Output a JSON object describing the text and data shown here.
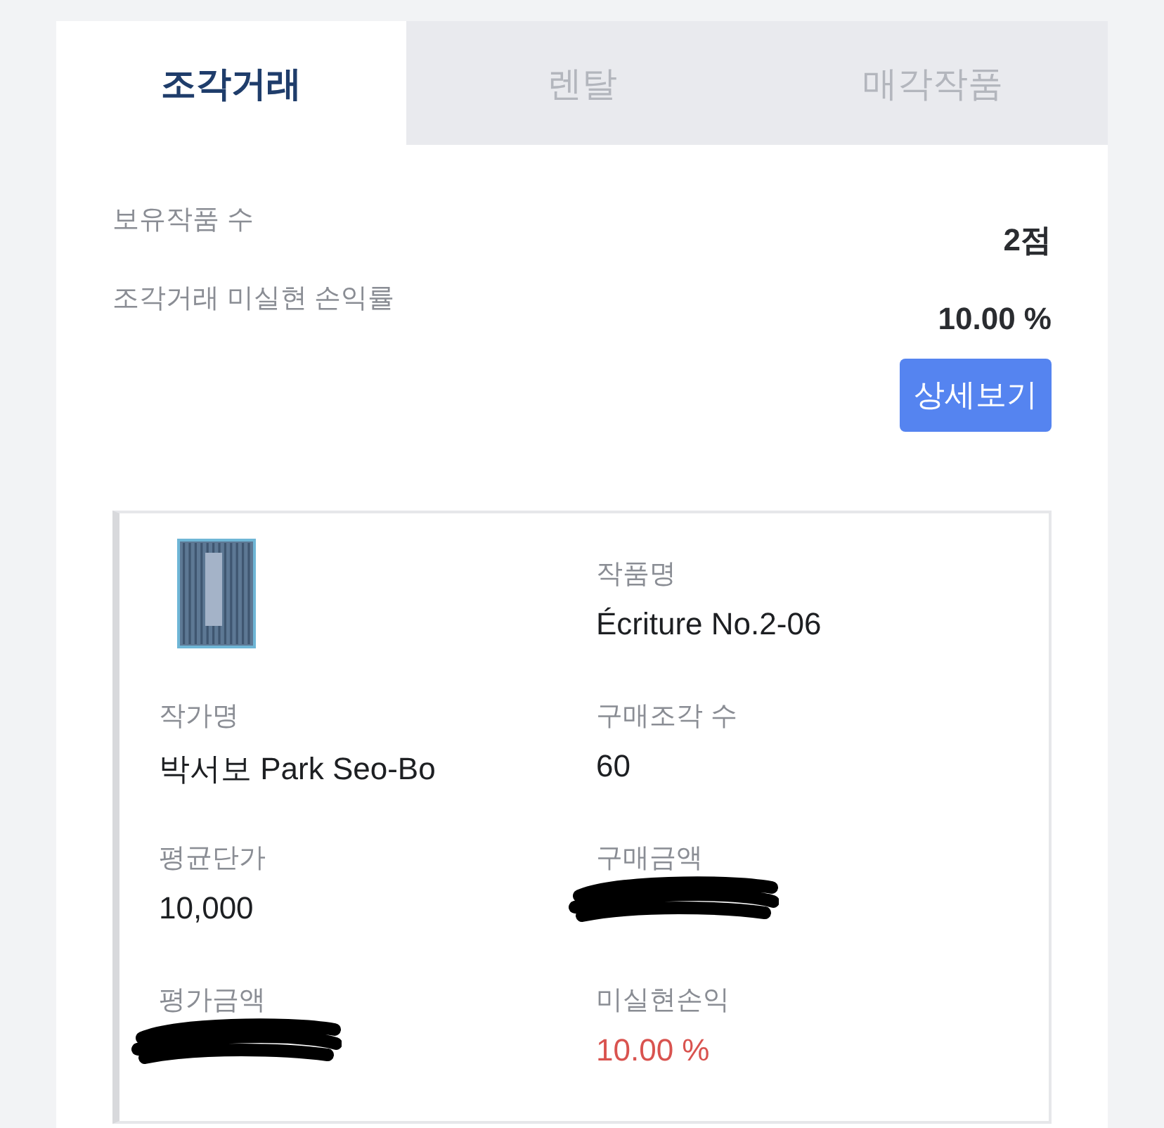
{
  "tabs": [
    {
      "label": "조각거래",
      "selected": true
    },
    {
      "label": "렌탈",
      "selected": false
    },
    {
      "label": "매각작품",
      "selected": false
    }
  ],
  "summary": [
    {
      "label": "보유작품 수",
      "value": "2점"
    },
    {
      "label": "조각거래 미실현 손익률",
      "value": "10.00 %"
    }
  ],
  "detail_button": "상세보기",
  "artwork": {
    "fields": [
      {
        "kind": "picture"
      },
      {
        "kind": "text",
        "label": "작품명",
        "value": "Écriture No.2-06"
      },
      {
        "kind": "text",
        "label": "작가명",
        "value": "박서보 Park Seo-Bo"
      },
      {
        "kind": "text",
        "label": "구매조각 수",
        "value": "60"
      },
      {
        "kind": "text",
        "label": "평균단가",
        "value": "10,000"
      },
      {
        "kind": "redacted",
        "label": "구매금액"
      },
      {
        "kind": "redacted",
        "label": "평가금액"
      },
      {
        "kind": "profit",
        "label": "미실현손익",
        "value": "10.00 %"
      }
    ]
  }
}
